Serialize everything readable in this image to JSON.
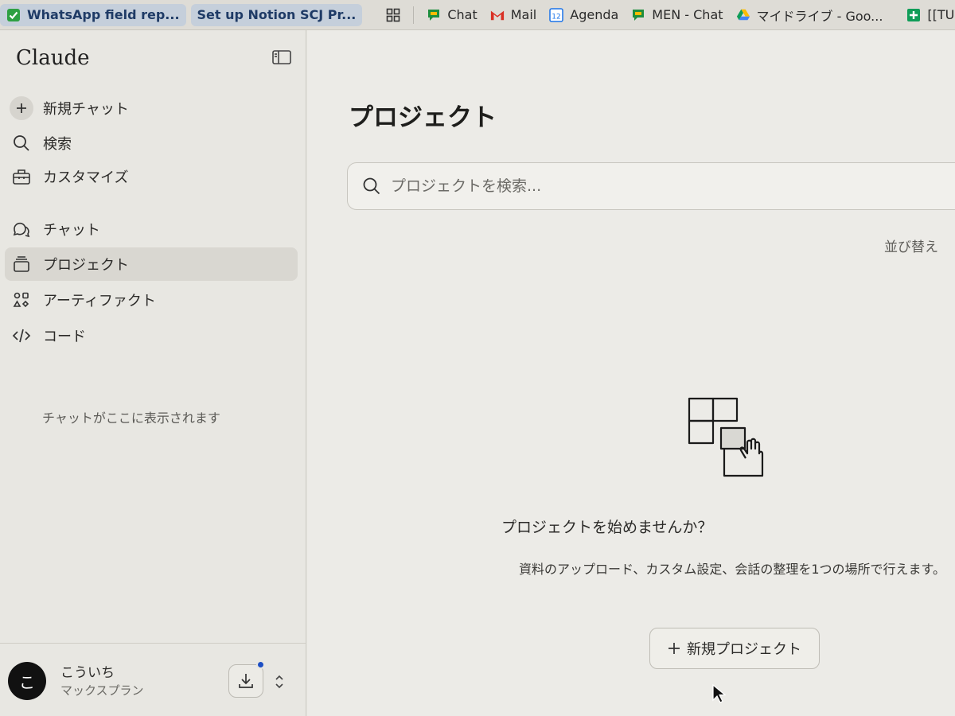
{
  "bookmarks": [
    {
      "label": "WhatsApp field rep...",
      "icon": "checkbox-icon",
      "pinned": true
    },
    {
      "label": "Set up Notion SCJ Pr...",
      "icon": "",
      "pinned": true
    },
    {
      "label": "",
      "icon": "apps-grid-icon"
    },
    {
      "label": "Chat",
      "icon": "google-chat-icon"
    },
    {
      "label": "Mail",
      "icon": "gmail-icon"
    },
    {
      "label": "Agenda",
      "icon": "calendar-icon",
      "badge": "12"
    },
    {
      "label": "MEN - Chat",
      "icon": "google-chat-icon"
    },
    {
      "label": "マイドライブ - Goo...",
      "icon": "google-drive-icon"
    },
    {
      "label": "[[TU",
      "icon": "sheets-plus-icon"
    }
  ],
  "sidebar": {
    "brand": "Claude",
    "primary": [
      {
        "label": "新規チャット",
        "icon": "plus-icon"
      },
      {
        "label": "検索",
        "icon": "search-icon"
      },
      {
        "label": "カスタマイズ",
        "icon": "toolbox-icon"
      }
    ],
    "sections": [
      {
        "label": "チャット",
        "icon": "chat-bubbles-icon"
      },
      {
        "label": "プロジェクト",
        "icon": "folder-stack-icon",
        "active": true
      },
      {
        "label": "アーティファクト",
        "icon": "artifacts-icon"
      },
      {
        "label": "コード",
        "icon": "code-icon"
      }
    ],
    "empty_hint": "チャットがここに表示されます",
    "user": {
      "initial": "こ",
      "name": "こういち",
      "plan": "マックスプラン"
    }
  },
  "main": {
    "title": "プロジェクト",
    "search": {
      "placeholder": "プロジェクトを検索..."
    },
    "sort_label": "並び替え",
    "empty_state": {
      "title": "プロジェクトを始めませんか？",
      "description": "資料のアップロード、カスタム設定、会話の整理を1つの場所で行えます。",
      "button": "新規プロジェクト"
    }
  },
  "colors": {
    "accent_dot": "#1d4fc4",
    "sidebar_bg": "#e8e7e2",
    "main_bg": "#ecebe7"
  }
}
